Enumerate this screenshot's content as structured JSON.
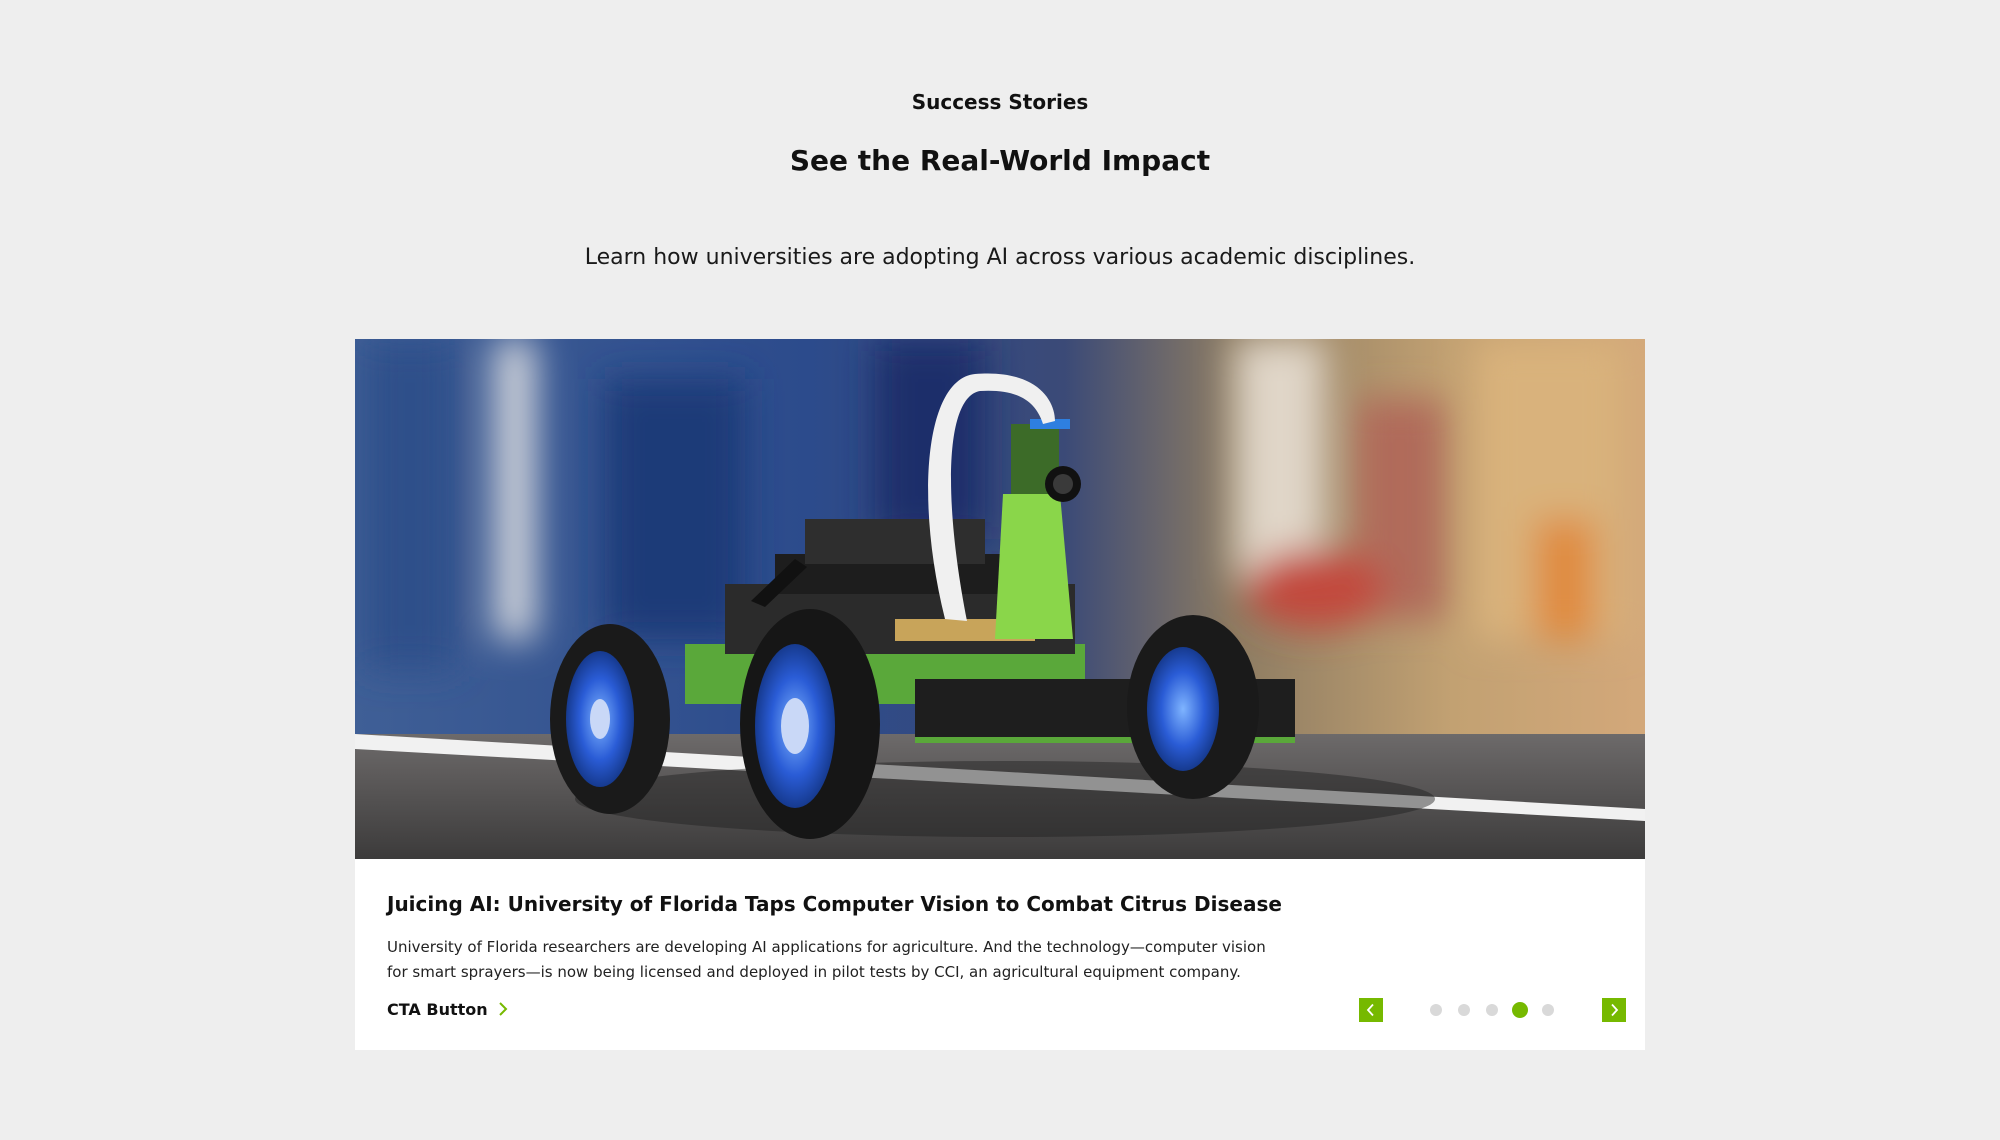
{
  "section": {
    "eyebrow": "Success Stories",
    "title": "See the Real-World Impact",
    "subtitle": "Learn how universities are adopting AI across various academic disciplines."
  },
  "card": {
    "image_alt": "",
    "title": "Juicing AI: University of Florida Taps Computer Vision to Combat Citrus Disease",
    "body": "University of Florida researchers are developing AI applications for agriculture. And the technology—computer vision for smart sprayers—is now being licensed and deployed in pilot tests by CCI, an agricultural equipment company.",
    "cta_label": "CTA Button"
  },
  "carousel": {
    "slide_count": 5,
    "active_index": 3,
    "prev_icon": "chevron-left-icon",
    "next_icon": "chevron-right-icon"
  },
  "colors": {
    "accent": "#76b900",
    "background": "#eeeeee",
    "card": "#ffffff",
    "dot_inactive": "#d9d9d9"
  }
}
